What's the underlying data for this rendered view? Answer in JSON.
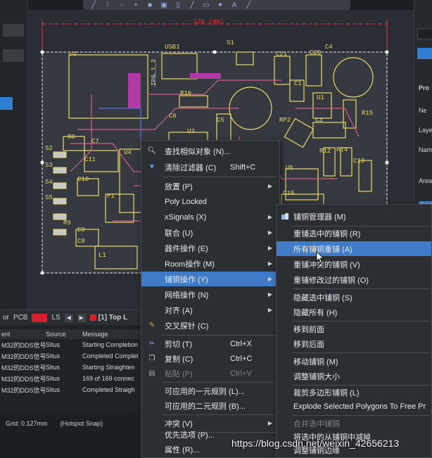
{
  "toolbar": {
    "icons": [
      "route-icon",
      "pad-icon",
      "via-icon",
      "add-icon",
      "fill-icon",
      "region-icon",
      "doc-icon",
      "line-icon",
      "component-icon",
      "pin-icon",
      "text-icon",
      "arrow-icon"
    ]
  },
  "pcb": {
    "dimension_label": "120 (mm)",
    "designators": [
      "U2",
      "USB1",
      "S1",
      "C21",
      "C20",
      "C4",
      "R16",
      "IP6_1_3",
      "C1",
      "U1",
      "R15",
      "C6",
      "U3",
      "C5",
      "RP2",
      "C3",
      "R8",
      "C7",
      "S2",
      "C11",
      "U4",
      "R12",
      "R14",
      "C13",
      "S3",
      "S4",
      "C10",
      "U5",
      "S5",
      "P1",
      "C19",
      "R9",
      "C9",
      "L1",
      "C8"
    ]
  },
  "right_panel": {
    "labels": [
      "Pro",
      "Ne",
      "Laye",
      "Name",
      "Area",
      "Sele"
    ]
  },
  "tab_bar": {
    "tab_or": "or",
    "tab_pcb": "PCB",
    "tab_ls": "LS",
    "prev": "◀",
    "next": "▶",
    "layer_label": "[1] Top L"
  },
  "messages": {
    "headers": [
      "ent",
      "Source",
      "Message"
    ],
    "rows": [
      {
        "doc": "M32的DDS信号",
        "source": "Situs",
        "message": "Starting Completion"
      },
      {
        "doc": "M32的DDS信号",
        "source": "Situs",
        "message": "Completed Complet"
      },
      {
        "doc": "M32的DDS信号",
        "source": "Situs",
        "message": "Starting Straighten"
      },
      {
        "doc": "M32的DDS信号",
        "source": "Situs",
        "message": "169 of 169 connec"
      },
      {
        "doc": "M32的DDS信号",
        "source": "Situs",
        "message": "Completed Straigh"
      }
    ]
  },
  "status_bar": {
    "grid": "Grid: 0.127mm",
    "snap": "(Hotspot Snap)"
  },
  "context_menu": {
    "items": [
      {
        "label": "查找相似对象 (N)...",
        "icon": "search-icon",
        "short": "",
        "arrow": false,
        "disabled": false
      },
      {
        "label": "清除过滤器 (C)",
        "icon": "filter-icon",
        "short": "Shift+C",
        "arrow": false,
        "disabled": false
      },
      {
        "label": "放置 (P)",
        "icon": "",
        "short": "",
        "arrow": true,
        "disabled": false
      },
      {
        "label": "Poly Locked",
        "icon": "",
        "short": "",
        "arrow": false,
        "disabled": false
      },
      {
        "label": "xSignals (X)",
        "icon": "",
        "short": "",
        "arrow": true,
        "disabled": false
      },
      {
        "label": "联合 (U)",
        "icon": "",
        "short": "",
        "arrow": true,
        "disabled": false
      },
      {
        "label": "器件操作 (E)",
        "icon": "",
        "short": "",
        "arrow": true,
        "disabled": false
      },
      {
        "label": "Room操作 (M)",
        "icon": "",
        "short": "",
        "arrow": true,
        "disabled": false
      },
      {
        "label": "铺铜操作 (Y)",
        "icon": "",
        "short": "",
        "arrow": true,
        "disabled": false
      },
      {
        "label": "网络操作 (N)",
        "icon": "",
        "short": "",
        "arrow": true,
        "disabled": false
      },
      {
        "label": "对齐 (A)",
        "icon": "",
        "short": "",
        "arrow": true,
        "disabled": false
      },
      {
        "label": "交叉探针 (C)",
        "icon": "probe-icon",
        "short": "",
        "arrow": false,
        "disabled": false
      },
      {
        "label": "剪切 (T)",
        "icon": "scissors-icon",
        "short": "Ctrl+X",
        "arrow": false,
        "disabled": false
      },
      {
        "label": "复制 (C)",
        "icon": "copy-icon",
        "short": "Ctrl+C",
        "arrow": false,
        "disabled": false
      },
      {
        "label": "粘贴 (P)",
        "icon": "paste-icon",
        "short": "Ctrl+V",
        "arrow": false,
        "disabled": true
      },
      {
        "label": "可应用的一元规则 (L)...",
        "icon": "",
        "short": "",
        "arrow": false,
        "disabled": false
      },
      {
        "label": "可应用的二元规则 (B)...",
        "icon": "",
        "short": "",
        "arrow": false,
        "disabled": false
      },
      {
        "label": "冲突 (V)",
        "icon": "",
        "short": "",
        "arrow": true,
        "disabled": false
      },
      {
        "label": "优先选项 (P)...",
        "icon": "",
        "short": "",
        "arrow": false,
        "disabled": false
      },
      {
        "label": "属性 (R)...",
        "icon": "",
        "short": "",
        "arrow": false,
        "disabled": false
      }
    ]
  },
  "submenu": {
    "items": [
      {
        "label": "铺铜管理器 (M)",
        "icon": true,
        "disabled": false
      },
      {
        "label": "重铺选中的铺铜 (R)",
        "icon": false,
        "disabled": false
      },
      {
        "label": "所有铺铜重铺 (A)",
        "icon": false,
        "disabled": false
      },
      {
        "label": "重铺冲突的铺铜 (V)",
        "icon": false,
        "disabled": false
      },
      {
        "label": "重铺修改过的铺铜 (O)",
        "icon": false,
        "disabled": false
      },
      {
        "label": "隐藏选中铺铜 (S)",
        "icon": false,
        "disabled": false
      },
      {
        "label": "隐藏所有 (H)",
        "icon": false,
        "disabled": false
      },
      {
        "label": "移到前面",
        "icon": false,
        "disabled": false
      },
      {
        "label": "移到后面",
        "icon": false,
        "disabled": false
      },
      {
        "label": "移动铺铜 (M)",
        "icon": false,
        "disabled": false
      },
      {
        "label": "调整铺铜大小",
        "icon": false,
        "disabled": false
      },
      {
        "label": "裁剪多边形铺铜 (L)",
        "icon": false,
        "disabled": false
      },
      {
        "label": "Explode Selected Polygons To Free Pr",
        "icon": false,
        "disabled": false
      },
      {
        "label": "合并选中铺铜",
        "icon": false,
        "disabled": true
      },
      {
        "label": "将选中的从铺铜中减掉",
        "icon": false,
        "disabled": false
      },
      {
        "label": "调整铺铜边缘",
        "icon": false,
        "disabled": false
      }
    ]
  },
  "watermark": "https://blog.csdn.net/weixin_42656213",
  "colors": {
    "highlight": "#3f7bc6",
    "menu_bg": "#2b2e33",
    "board_outline": "#e8e8e8",
    "silkscreen": "#e9d96a",
    "dimension": "#e0343a"
  }
}
